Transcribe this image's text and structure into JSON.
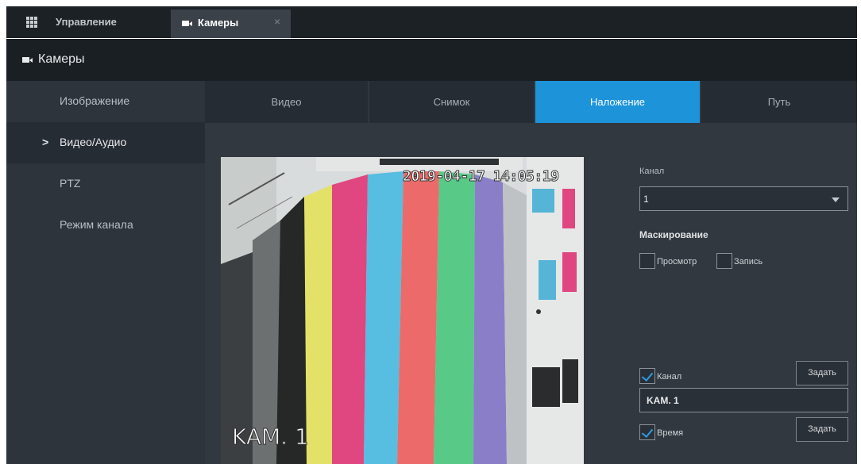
{
  "top_tabs": {
    "manage_label": "Управление",
    "cameras_label": "Камеры",
    "close_glyph": "×"
  },
  "header": {
    "title": "Камеры"
  },
  "sidebar": {
    "items": [
      {
        "label": "Изображение",
        "active": false
      },
      {
        "label": "Видео/Аудио",
        "active": true
      },
      {
        "label": "PTZ",
        "active": false
      },
      {
        "label": "Режим канала",
        "active": false
      }
    ],
    "active_marker": ">"
  },
  "subtabs": [
    {
      "label": "Видео",
      "active": false
    },
    {
      "label": "Снимок",
      "active": false
    },
    {
      "label": "Наложение",
      "active": true
    },
    {
      "label": "Путь",
      "active": false
    }
  ],
  "preview": {
    "timestamp": "2019-04-17 14:05:19",
    "channel_name": "KAM. 1"
  },
  "panel": {
    "channel_label": "Канал",
    "channel_value": "1",
    "masking_title": "Маскирование",
    "preview_checkbox_label": "Просмотр",
    "preview_checked": false,
    "record_checkbox_label": "Запись",
    "record_checked": false,
    "channel_checkbox_label": "Канал",
    "channel_checked": true,
    "set_button_label": "Задать",
    "channel_name_value": "KAM. 1",
    "time_checkbox_label": "Время",
    "time_checked": true
  },
  "colors": {
    "accent": "#1d93da",
    "check": "#2e9ae0",
    "topbar_bg": "#1c2126",
    "sidebar_bg": "#2d343c",
    "main_bg": "#31383f"
  },
  "icons": {
    "apps": "grid-icon",
    "camera": "camera-icon",
    "close": "close-icon",
    "dropdown": "chevron-down-icon",
    "check": "checkmark-icon"
  }
}
